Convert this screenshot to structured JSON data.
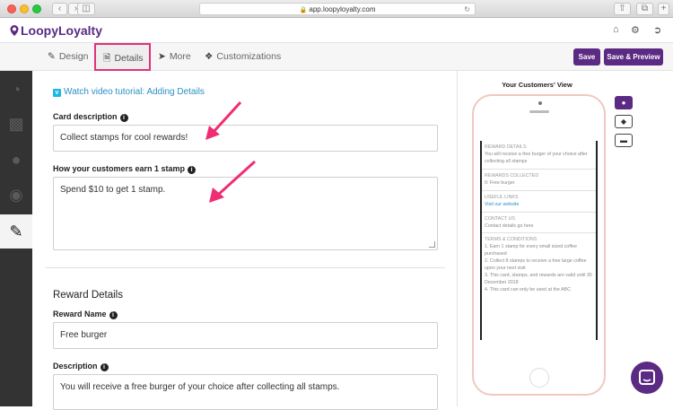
{
  "browser": {
    "url": "app.loopyloyalty.com",
    "back_icon": "chevron-left-icon",
    "forward_icon": "chevron-right-icon"
  },
  "app": {
    "logo": "LoopyLoyalty",
    "brand_color": "#5b2a83",
    "highlight_color": "#e0327a"
  },
  "tabs": [
    {
      "label": "Design",
      "icon": "brush-icon"
    },
    {
      "label": "Details",
      "icon": "document-icon"
    },
    {
      "label": "More",
      "icon": "location-arrow-icon"
    },
    {
      "label": "Customizations",
      "icon": "tags-icon"
    }
  ],
  "actions": {
    "save": "Save",
    "save_preview": "Save & Preview"
  },
  "form": {
    "video_link": "Watch video tutorial: Adding Details",
    "card_description_label": "Card description",
    "card_description_value": "Collect stamps for cool rewards!",
    "earn_label": "How your customers earn 1 stamp",
    "earn_value": "Spend $10 to get 1 stamp.",
    "reward_section": "Reward Details",
    "reward_name_label": "Reward Name",
    "reward_name_value": "Free burger",
    "description_label": "Description",
    "description_value": "You will receive a free burger of your choice after collecting all stamps."
  },
  "preview": {
    "title": "Your Customers' View",
    "reward_details_h": "REWARD DETAILS",
    "reward_details_t": "You will receive a free burger of your choice after collecting all stamps",
    "rewards_collected_h": "REWARDS COLLECTED",
    "rewards_collected_t": "0: Free burger",
    "useful_links_h": "USEFUL LINKS",
    "useful_links_t": "Visit our website",
    "contact_h": "CONTACT US",
    "contact_t": "Contact details go here",
    "terms_h": "TERMS & CONDITIONS",
    "terms_1": "1. Earn 1 stamp for every small sized coffee purchased",
    "terms_2": "2. Collect 8 stamps to receive a free large coffee upon your next visit",
    "terms_3": "3. This card, stamps, and rewards are valid until 30 December 2018",
    "terms_4": "4. This card can only be used at the ABC"
  }
}
